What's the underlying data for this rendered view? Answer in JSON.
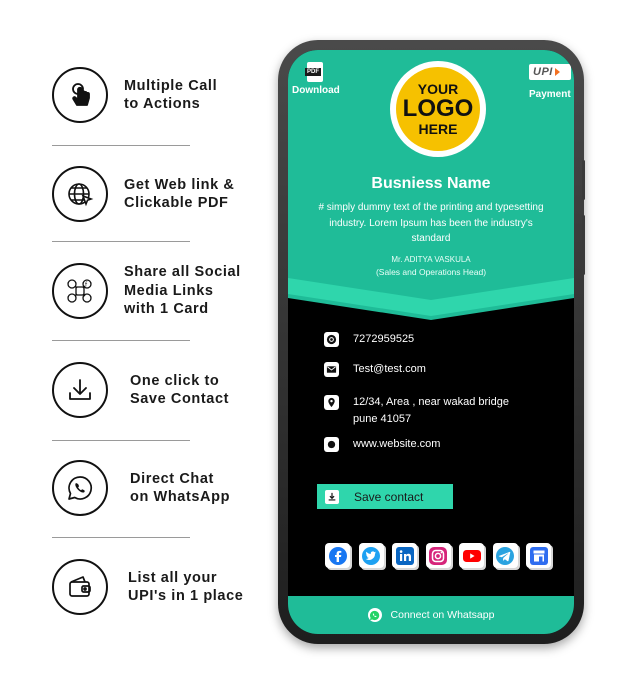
{
  "features": [
    {
      "icon": "touch-hand-icon",
      "label": "Multiple Call\nto Actions"
    },
    {
      "icon": "globe-cursor-icon",
      "label": "Get Web link &\nClickable PDF"
    },
    {
      "icon": "social-network-icon",
      "label": "Share all Social\nMedia Links\nwith 1 Card"
    },
    {
      "icon": "download-tray-icon",
      "label": "One click to\nSave Contact"
    },
    {
      "icon": "whatsapp-icon",
      "label": "Direct Chat\non WhatsApp"
    },
    {
      "icon": "wallet-icon",
      "label": "List all your\nUPI's in 1 place"
    }
  ],
  "card": {
    "download": {
      "badge": "PDF",
      "label": "Download"
    },
    "payment": {
      "badge": "UPI",
      "label": "Payment"
    },
    "logo": {
      "line1": "YOUR",
      "line2": "LOGO",
      "line3": "HERE"
    },
    "business_name": "Busniess Name",
    "description": "# simply dummy text of the printing and typesetting industry. Lorem Ipsum has been the industry's standard",
    "person_name": "Mr. ADITYA VASKULA",
    "person_role": "(Sales and Operations Head)",
    "contacts": {
      "phone": "7272959525",
      "email": "Test@test.com",
      "address": "12/34, Area , near wakad bridge pune 41057",
      "website": "www.website.com"
    },
    "save_contact": "Save contact",
    "connect_whatsapp": "Connect on Whatsapp"
  },
  "colors": {
    "teal": "#1fbc98",
    "teal_light": "#2fd6ac",
    "logo_yellow": "#f6c100",
    "background": "#ffffff",
    "card_dark": "#000000"
  },
  "social_icons": [
    "facebook-icon",
    "twitter-icon",
    "linkedin-icon",
    "instagram-icon",
    "youtube-icon",
    "telegram-icon",
    "store-icon"
  ]
}
